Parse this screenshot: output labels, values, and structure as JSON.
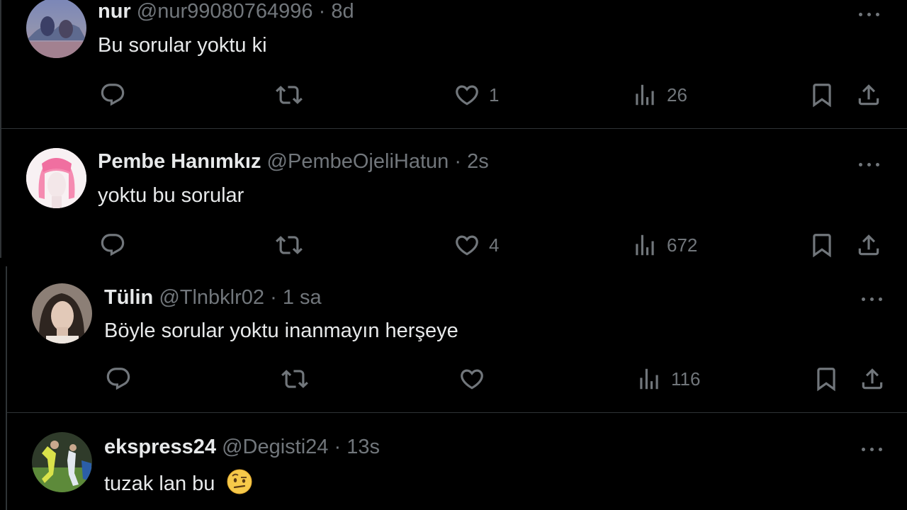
{
  "tweets": [
    {
      "name": "nur",
      "handle": "@nur99080764996",
      "time": "8d",
      "text": "Bu sorular yoktu ki",
      "likes": "1",
      "views": "26"
    },
    {
      "name": "Pembe Hanımkız",
      "handle": "@PembeOjeliHatun",
      "time": "2s",
      "text": "yoktu bu sorular",
      "likes": "4",
      "views": "672"
    },
    {
      "name": "Tülin",
      "handle": "@Tlnbklr02",
      "time": "1 sa",
      "text": "Böyle sorular yoktu inanmayın herşeye",
      "likes": "",
      "views": "116"
    },
    {
      "name": "ekspress24",
      "handle": "@Degisti24",
      "time": "13s",
      "text": "tuzak lan bu",
      "emoji": "face-with-raised-eyebrow"
    }
  ],
  "separator": "·",
  "icons": [
    "reply-icon",
    "retweet-icon",
    "like-icon",
    "views-icon",
    "bookmark-icon",
    "share-icon",
    "more-icon"
  ],
  "colors": {
    "background": "#000000",
    "text": "#e7e9ea",
    "muted": "#71767b",
    "border": "#2f3336"
  }
}
